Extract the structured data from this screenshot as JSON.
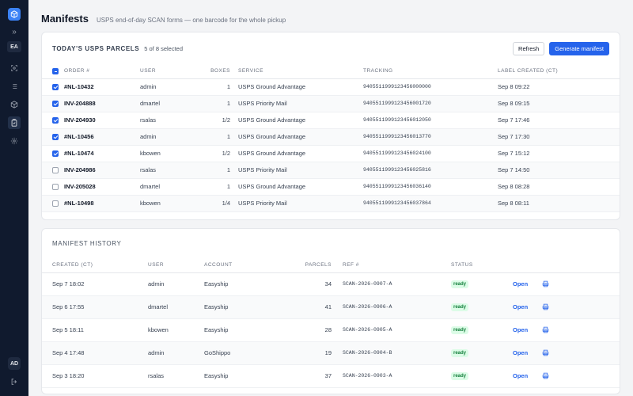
{
  "sidebar": {
    "org_initials": "EA",
    "user_initials": "AD",
    "nav": [
      {
        "name": "scan-icon"
      },
      {
        "name": "list-icon"
      },
      {
        "name": "box-icon"
      },
      {
        "name": "clipboard-icon",
        "active": true
      },
      {
        "name": "gear-icon"
      }
    ]
  },
  "header": {
    "title": "Manifests",
    "subtitle": "USPS end-of-day SCAN forms — one barcode for the whole pickup"
  },
  "parcels": {
    "title": "TODAY'S USPS PARCELS",
    "selection": "5 of 8 selected",
    "refresh_label": "Refresh",
    "generate_label": "Generate manifest",
    "columns": {
      "order": "ORDER #",
      "user": "USER",
      "boxes": "BOXES",
      "service": "SERVICE",
      "tracking": "TRACKING",
      "label_created": "LABEL CREATED (CT)"
    },
    "rows": [
      {
        "checked": true,
        "order": "#NL-10432",
        "user": "admin",
        "boxes": "1",
        "service": "USPS Ground Advantage",
        "tracking": "9405511999123456000000",
        "created": "Sep 8 09:22"
      },
      {
        "checked": true,
        "order": "INV-204888",
        "user": "dmartel",
        "boxes": "1",
        "service": "USPS Priority Mail",
        "tracking": "9405511999123456001720",
        "created": "Sep 8 09:15"
      },
      {
        "checked": true,
        "order": "INV-204930",
        "user": "rsalas",
        "boxes": "1/2",
        "service": "USPS Ground Advantage",
        "tracking": "9405511999123456012050",
        "created": "Sep 7 17:46"
      },
      {
        "checked": true,
        "order": "#NL-10456",
        "user": "admin",
        "boxes": "1",
        "service": "USPS Ground Advantage",
        "tracking": "9405511999123456013770",
        "created": "Sep 7 17:30"
      },
      {
        "checked": true,
        "order": "#NL-10474",
        "user": "kbowen",
        "boxes": "1/2",
        "service": "USPS Ground Advantage",
        "tracking": "9405511999123456024100",
        "created": "Sep 7 15:12"
      },
      {
        "checked": false,
        "order": "INV-204986",
        "user": "rsalas",
        "boxes": "1",
        "service": "USPS Priority Mail",
        "tracking": "9405511999123456025816",
        "created": "Sep 7 14:50"
      },
      {
        "checked": false,
        "order": "INV-205028",
        "user": "dmartel",
        "boxes": "1",
        "service": "USPS Ground Advantage",
        "tracking": "9405511999123456036140",
        "created": "Sep 8 08:28"
      },
      {
        "checked": false,
        "order": "#NL-10498",
        "user": "kbowen",
        "boxes": "1/4",
        "service": "USPS Priority Mail",
        "tracking": "9405511999123456037864",
        "created": "Sep 8 08:11"
      }
    ]
  },
  "history": {
    "title": "MANIFEST HISTORY",
    "columns": {
      "created": "CREATED (CT)",
      "user": "USER",
      "account": "ACCOUNT",
      "parcels": "PARCELS",
      "ref": "REF #",
      "status": "STATUS"
    },
    "open_label": "Open",
    "rows": [
      {
        "created": "Sep 7 18:02",
        "user": "admin",
        "account": "Easyship",
        "parcels": "34",
        "ref": "SCAN-2026-0907-A",
        "status": "ready"
      },
      {
        "created": "Sep 6 17:55",
        "user": "dmartel",
        "account": "Easyship",
        "parcels": "41",
        "ref": "SCAN-2026-0906-A",
        "status": "ready"
      },
      {
        "created": "Sep 5 18:11",
        "user": "kbowen",
        "account": "Easyship",
        "parcels": "28",
        "ref": "SCAN-2026-0905-A",
        "status": "ready"
      },
      {
        "created": "Sep 4 17:48",
        "user": "admin",
        "account": "GoShippo",
        "parcels": "19",
        "ref": "SCAN-2026-0904-B",
        "status": "ready"
      },
      {
        "created": "Sep 3 18:20",
        "user": "rsalas",
        "account": "Easyship",
        "parcels": "37",
        "ref": "SCAN-2026-0903-A",
        "status": "ready"
      }
    ]
  }
}
